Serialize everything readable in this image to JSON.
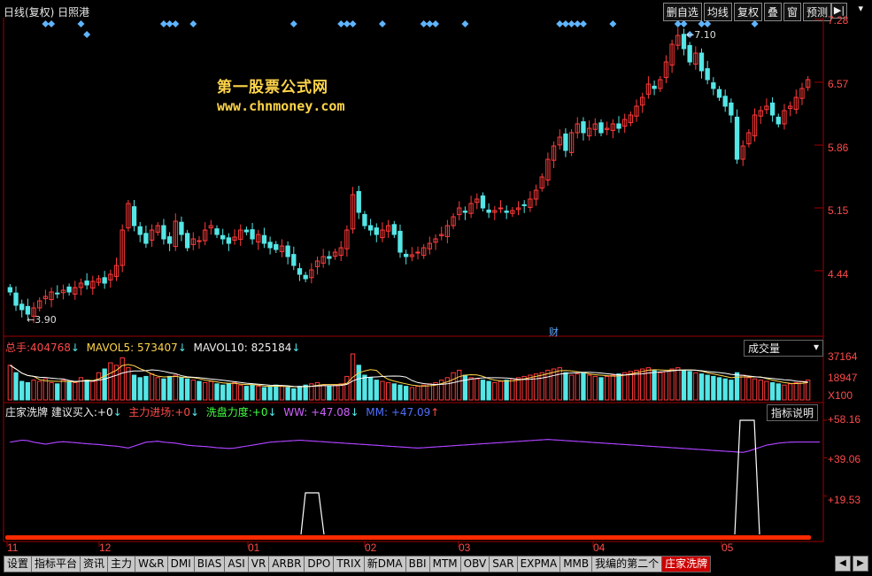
{
  "header": {
    "title": "日线(复权) 日照港",
    "buttons": [
      "删自选",
      "均线",
      "复权",
      "叠",
      "窗",
      "预测"
    ],
    "arrow_label": "▶|"
  },
  "watermark": {
    "line1": "第一股票公式网",
    "line2": "www.chnmoney.com"
  },
  "price_axis": {
    "labels": [
      "7.28",
      "6.57",
      "5.86",
      "5.15",
      "4.44"
    ]
  },
  "annotations": {
    "high": "7.10",
    "low": "3.90",
    "cai": "财"
  },
  "volume_panel": {
    "label_total": "总手:",
    "total_value": "404768",
    "ma5_label": "MAVOL5:",
    "ma5_value": "573407",
    "ma10_label": "MAVOL10:",
    "ma10_value": "825184",
    "dropdown": "成交量",
    "axis": [
      "37164",
      "18947",
      "X100"
    ]
  },
  "indicator_panel": {
    "name": "庄家洗牌",
    "f1_label": "建议买入:",
    "f1_value": "+0",
    "f2_label": "主力进场:",
    "f2_value": "+0",
    "f3_label": "洗盘力度:",
    "f3_value": "+0",
    "f4_label": "WW:",
    "f4_value": "+47.08",
    "f5_label": "MM:",
    "f5_value": "+47.09",
    "help_button": "指标说明",
    "axis": [
      "+58.16",
      "+39.06",
      "+19.53"
    ]
  },
  "x_axis": {
    "labels": [
      "11",
      "12",
      "01",
      "02",
      "03",
      "04",
      "05"
    ]
  },
  "bottom_tabs": [
    "设置",
    "指标平台",
    "资讯",
    "主力",
    "W&R",
    "DMI",
    "BIAS",
    "ASI",
    "VR",
    "ARBR",
    "DPO",
    "TRIX",
    "新DMA",
    "BBI",
    "MTM",
    "OBV",
    "SAR",
    "EXPMA",
    "MMB",
    "我编的第二个",
    "庄家洗牌"
  ],
  "active_tab": "庄家洗牌",
  "colors": {
    "up": "#ff3a3a",
    "down": "#55e6e6",
    "axis": "#a00000",
    "ww": "#c040ff",
    "mm": "#3050ff",
    "signal": "#ffffff",
    "base": "#ff2a00"
  },
  "chart_data": [
    {
      "type": "candlestick",
      "title": "日线(复权) 日照港",
      "ylim": [
        3.9,
        7.28
      ],
      "close": [
        4.2,
        4.05,
        4.0,
        3.95,
        4.02,
        4.1,
        4.15,
        4.2,
        4.18,
        4.22,
        4.2,
        4.25,
        4.3,
        4.28,
        4.32,
        4.35,
        4.3,
        4.4,
        4.5,
        4.9,
        5.2,
        4.95,
        4.85,
        4.75,
        4.9,
        4.95,
        4.8,
        4.75,
        5.0,
        4.85,
        4.7,
        4.8,
        4.78,
        4.9,
        4.95,
        4.85,
        4.8,
        4.75,
        4.82,
        4.9,
        4.88,
        4.8,
        4.85,
        4.75,
        4.7,
        4.68,
        4.72,
        4.6,
        4.5,
        4.4,
        4.35,
        4.45,
        4.55,
        4.6,
        4.58,
        4.65,
        4.7,
        4.9,
        5.3,
        5.1,
        4.95,
        4.9,
        4.85,
        4.9,
        4.95,
        4.85,
        4.65,
        4.6,
        4.62,
        4.65,
        4.7,
        4.75,
        4.8,
        4.85,
        4.95,
        5.05,
        5.15,
        5.1,
        5.2,
        5.25,
        5.15,
        5.1,
        5.12,
        5.15,
        5.1,
        5.12,
        5.15,
        5.18,
        5.25,
        5.35,
        5.5,
        5.7,
        5.85,
        5.95,
        5.8,
        6.0,
        6.1,
        6.0,
        6.05,
        6.1,
        6.0,
        6.05,
        6.1,
        6.05,
        6.15,
        6.2,
        6.3,
        6.4,
        6.55,
        6.5,
        6.6,
        6.8,
        7.0,
        7.1,
        6.95,
        6.8,
        6.9,
        6.7,
        6.6,
        6.5,
        6.4,
        6.3,
        6.2,
        5.7,
        5.85,
        6.0,
        6.2,
        6.25,
        6.3,
        6.2,
        6.1,
        6.25,
        6.3,
        6.4,
        6.5,
        6.6
      ]
    },
    {
      "type": "bar",
      "title": "成交量",
      "ylim": [
        0,
        37164
      ],
      "values": [
        28000,
        22000,
        15000,
        14000,
        16000,
        15000,
        17000,
        14000,
        13000,
        16000,
        15000,
        14000,
        18000,
        16000,
        15000,
        22000,
        25000,
        30000,
        28000,
        34000,
        26000,
        20000,
        18000,
        19000,
        21000,
        18000,
        17000,
        19000,
        20000,
        18000,
        17000,
        16000,
        15000,
        14000,
        15000,
        13000,
        12000,
        13000,
        14000,
        12000,
        11000,
        12000,
        11000,
        10000,
        11000,
        12000,
        11000,
        10000,
        9000,
        11000,
        12000,
        13000,
        14000,
        12000,
        11000,
        12000,
        13000,
        19000,
        37164,
        28000,
        20000,
        18000,
        16000,
        15000,
        14000,
        13000,
        12000,
        11000,
        10000,
        11000,
        12000,
        13000,
        14000,
        16000,
        18000,
        22000,
        24000,
        20000,
        18000,
        17000,
        16000,
        15000,
        14000,
        15000,
        16000,
        17000,
        18000,
        19000,
        20000,
        21000,
        22000,
        24000,
        25000,
        26000,
        22000,
        20000,
        21000,
        22000,
        20000,
        19000,
        18000,
        19000,
        20000,
        21000,
        22000,
        23000,
        24000,
        25000,
        26000,
        24000,
        22000,
        23000,
        25000,
        26000,
        24000,
        23000,
        22000,
        21000,
        20000,
        19000,
        18000,
        17000,
        16000,
        22000,
        20000,
        18000,
        17000,
        16000,
        15000,
        14000,
        13000,
        12000,
        13000,
        14000,
        15000,
        16000
      ]
    },
    {
      "type": "line",
      "title": "庄家洗牌",
      "ylim": [
        0,
        58.16
      ],
      "series": [
        {
          "name": "WW",
          "values": [
            47,
            47.5,
            48,
            47.8,
            47,
            46.5,
            46,
            46.5,
            47,
            47.2,
            47,
            46.8,
            46.5,
            46.2,
            46,
            45.8,
            45.5,
            45.2,
            45,
            44.5,
            44,
            45,
            46,
            47,
            47.2,
            47.5,
            47,
            46.8,
            46.5,
            46,
            45.5,
            45.2,
            45,
            44.8,
            44.5,
            44.2,
            44,
            43.8,
            44,
            44.5,
            45,
            45.5,
            46,
            46.5,
            47,
            47.2,
            47.4,
            47.6,
            47.8,
            48,
            47.8,
            47.6,
            47.4,
            47.2,
            47,
            46.8,
            46.6,
            46.4,
            46.2,
            46,
            45.8,
            45.6,
            45.4,
            45.2,
            45,
            44.8,
            44.6,
            44.4,
            44.2,
            44,
            44.2,
            44.4,
            44.6,
            44.8,
            45,
            45.2,
            45.4,
            45.6,
            45.8,
            46,
            46.2,
            46.4,
            46.6,
            46.8,
            47,
            47.2,
            47.4,
            47.6,
            47.8,
            48,
            48.2,
            48.4,
            48.2,
            48,
            47.8,
            47.6,
            47.4,
            47.2,
            47,
            46.8,
            46.6,
            46.4,
            46.2,
            46,
            45.8,
            45.6,
            45.4,
            45.2,
            45,
            44.8,
            44.6,
            44.4,
            44.2,
            44,
            43.8,
            43.6,
            43.4,
            43.2,
            43,
            42.8,
            42.6,
            42.4,
            42.2,
            42,
            41.8,
            42.5,
            43.5,
            44.5,
            45.5,
            46,
            46.5,
            46.8,
            47,
            47.08,
            47.08,
            47.08,
            47.08,
            47.08
          ]
        },
        {
          "name": "MM",
          "values": [
            47,
            47.5,
            48,
            47.8,
            47,
            46.5,
            46,
            46.5,
            47,
            47.2,
            47,
            46.8,
            46.5,
            46.2,
            46,
            45.8,
            45.5,
            45.2,
            45,
            44.5,
            44,
            45,
            46,
            47,
            47.2,
            47.5,
            47,
            46.8,
            46.5,
            46,
            45.5,
            45.2,
            45,
            44.8,
            44.5,
            44.2,
            44,
            43.8,
            44,
            44.5,
            45,
            45.5,
            46,
            46.5,
            47,
            47.2,
            47.4,
            47.6,
            47.8,
            48,
            47.8,
            47.6,
            47.4,
            47.2,
            47,
            46.8,
            46.6,
            46.4,
            46.2,
            46,
            45.8,
            45.6,
            45.4,
            45.2,
            45,
            44.8,
            44.6,
            44.4,
            44.2,
            44,
            44.2,
            44.4,
            44.6,
            44.8,
            45,
            45.2,
            45.4,
            45.6,
            45.8,
            46,
            46.2,
            46.4,
            46.6,
            46.8,
            47,
            47.2,
            47.4,
            47.6,
            47.8,
            48,
            48.2,
            48.4,
            48.2,
            48,
            47.8,
            47.6,
            47.4,
            47.2,
            47,
            46.8,
            46.6,
            46.4,
            46.2,
            46,
            45.8,
            45.6,
            45.4,
            45.2,
            45,
            44.8,
            44.6,
            44.4,
            44.2,
            44,
            43.8,
            43.6,
            43.4,
            43.2,
            43,
            42.8,
            42.6,
            42.4,
            42.2,
            42,
            41.8,
            42.5,
            43.5,
            44.5,
            45.5,
            46,
            46.5,
            46.8,
            47,
            47.09,
            47.09,
            47.09,
            47.09,
            47.09
          ]
        }
      ]
    }
  ]
}
